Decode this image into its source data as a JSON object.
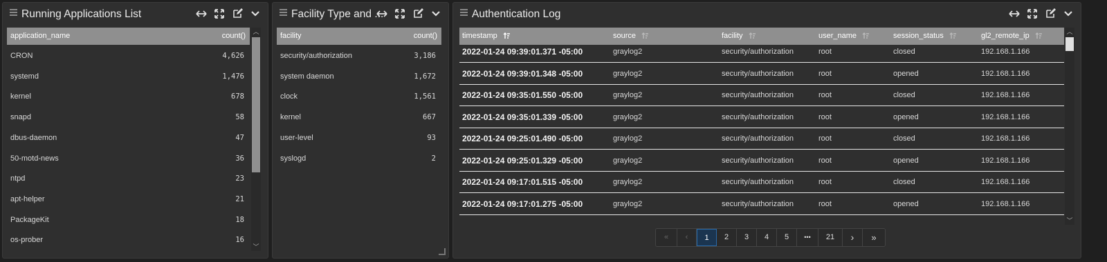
{
  "panels": {
    "apps": {
      "title": "Running Applications List",
      "columns": [
        "application_name",
        "count()"
      ],
      "rows": [
        {
          "name": "CRON",
          "count": "4,626"
        },
        {
          "name": "systemd",
          "count": "1,476"
        },
        {
          "name": "kernel",
          "count": "678"
        },
        {
          "name": "snapd",
          "count": "58"
        },
        {
          "name": "dbus-daemon",
          "count": "47"
        },
        {
          "name": "50-motd-news",
          "count": "36"
        },
        {
          "name": "ntpd",
          "count": "23"
        },
        {
          "name": "apt-helper",
          "count": "21"
        },
        {
          "name": "PackageKit",
          "count": "18"
        },
        {
          "name": "os-prober",
          "count": "16"
        }
      ]
    },
    "facility": {
      "title": "Facility Type and ...",
      "columns": [
        "facility",
        "count()"
      ],
      "rows": [
        {
          "name": "security/authorization",
          "count": "3,186"
        },
        {
          "name": "system daemon",
          "count": "1,672"
        },
        {
          "name": "clock",
          "count": "1,561"
        },
        {
          "name": "kernel",
          "count": "667"
        },
        {
          "name": "user-level",
          "count": "93"
        },
        {
          "name": "syslogd",
          "count": "2"
        }
      ]
    },
    "auth": {
      "title": "Authentication Log",
      "columns": [
        "timestamp",
        "source",
        "facility",
        "user_name",
        "session_status",
        "gl2_remote_ip"
      ],
      "rows": [
        {
          "timestamp": "2022-01-24 09:39:01.371 -05:00",
          "source": "graylog2",
          "facility": "security/authorization",
          "user_name": "root",
          "session_status": "closed",
          "ip": "192.168.1.166"
        },
        {
          "timestamp": "2022-01-24 09:39:01.348 -05:00",
          "source": "graylog2",
          "facility": "security/authorization",
          "user_name": "root",
          "session_status": "opened",
          "ip": "192.168.1.166"
        },
        {
          "timestamp": "2022-01-24 09:35:01.550 -05:00",
          "source": "graylog2",
          "facility": "security/authorization",
          "user_name": "root",
          "session_status": "closed",
          "ip": "192.168.1.166"
        },
        {
          "timestamp": "2022-01-24 09:35:01.339 -05:00",
          "source": "graylog2",
          "facility": "security/authorization",
          "user_name": "root",
          "session_status": "opened",
          "ip": "192.168.1.166"
        },
        {
          "timestamp": "2022-01-24 09:25:01.490 -05:00",
          "source": "graylog2",
          "facility": "security/authorization",
          "user_name": "root",
          "session_status": "closed",
          "ip": "192.168.1.166"
        },
        {
          "timestamp": "2022-01-24 09:25:01.329 -05:00",
          "source": "graylog2",
          "facility": "security/authorization",
          "user_name": "root",
          "session_status": "opened",
          "ip": "192.168.1.166"
        },
        {
          "timestamp": "2022-01-24 09:17:01.515 -05:00",
          "source": "graylog2",
          "facility": "security/authorization",
          "user_name": "root",
          "session_status": "closed",
          "ip": "192.168.1.166"
        },
        {
          "timestamp": "2022-01-24 09:17:01.275 -05:00",
          "source": "graylog2",
          "facility": "security/authorization",
          "user_name": "root",
          "session_status": "opened",
          "ip": "192.168.1.166"
        }
      ],
      "pagination": {
        "first": "«",
        "prev": "‹",
        "pages": [
          "1",
          "2",
          "3",
          "4",
          "5",
          "•••",
          "21"
        ],
        "active": "1",
        "next": "›",
        "last": "»"
      }
    }
  },
  "icons": [
    "drag-handle-icon",
    "expand-width-icon",
    "fullscreen-icon",
    "edit-icon",
    "chevron-down-icon",
    "sort-icon"
  ],
  "colors": {
    "background": "#1f1f1f",
    "panel": "#2f2f2f",
    "table_header": "#8f8f8f",
    "active_page": "#1b3550"
  }
}
